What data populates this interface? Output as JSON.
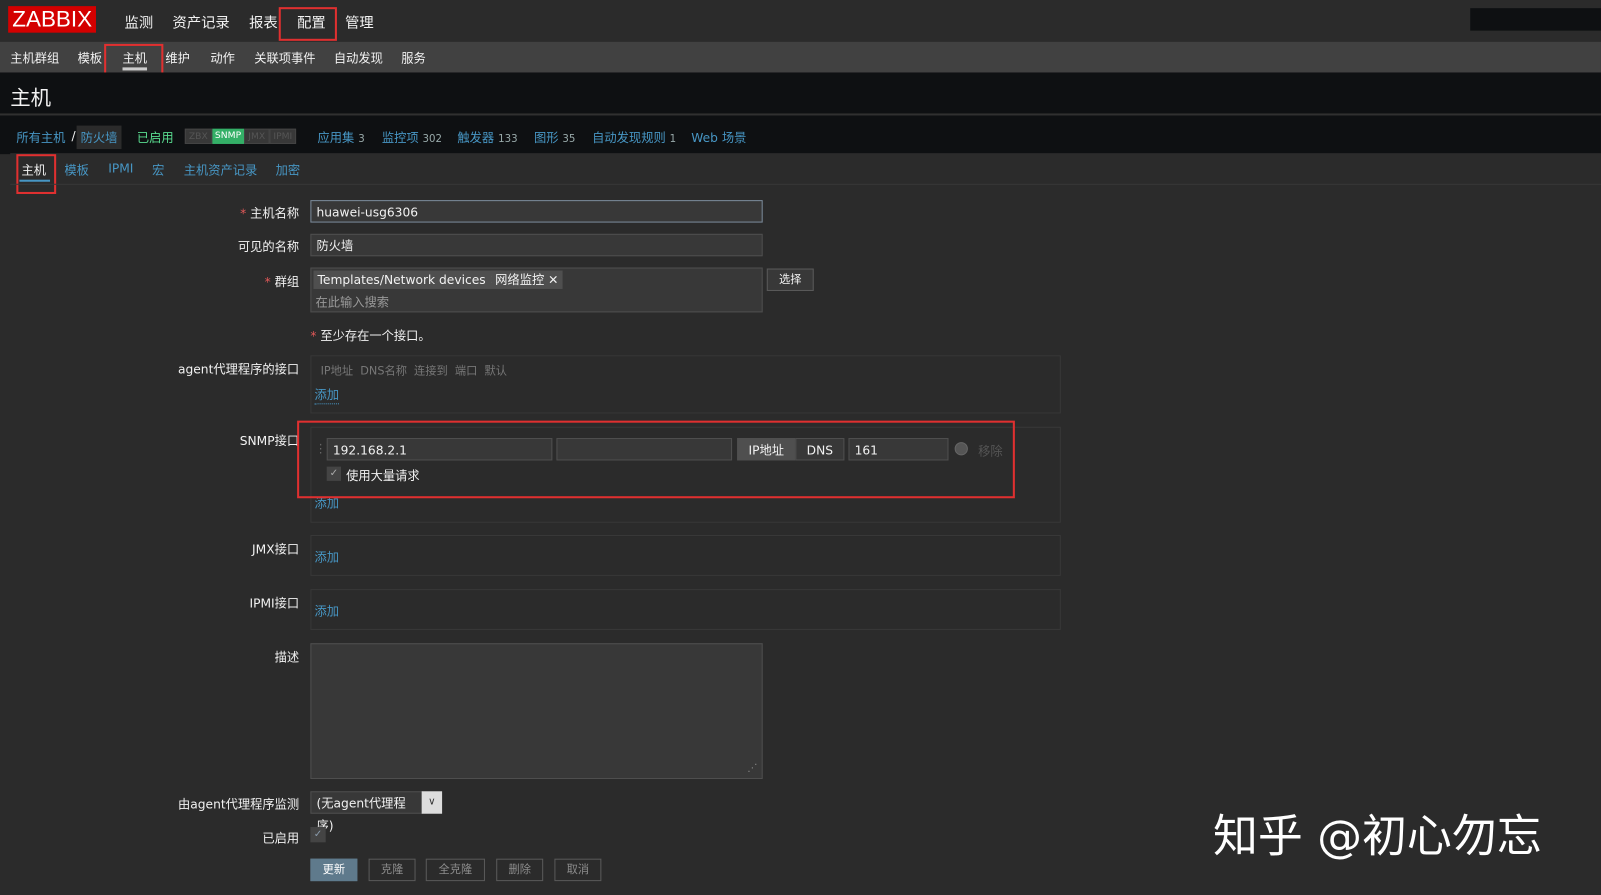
{
  "app": {
    "logo": "ZABBIX"
  },
  "main_menu": [
    "监测",
    "资产记录",
    "报表",
    "配置",
    "管理"
  ],
  "sub_menu": [
    "主机群组",
    "模板",
    "主机",
    "维护",
    "动作",
    "关联项事件",
    "自动发现",
    "服务"
  ],
  "page_title": "主机",
  "breadcrumb": {
    "all_hosts": "所有主机",
    "sep": "/",
    "host": "防火墙",
    "status": "已启用",
    "avail": [
      "ZBX",
      "SNMP",
      "JMX",
      "IPMI"
    ],
    "links": [
      {
        "label": "应用集",
        "count": "3"
      },
      {
        "label": "监控项",
        "count": "302"
      },
      {
        "label": "触发器",
        "count": "133"
      },
      {
        "label": "图形",
        "count": "35"
      },
      {
        "label": "自动发现规则",
        "count": "1"
      },
      {
        "label": "Web 场景",
        "count": ""
      }
    ]
  },
  "tabs": [
    "主机",
    "模板",
    "IPMI",
    "宏",
    "主机资产记录",
    "加密"
  ],
  "form": {
    "host_name_label": "主机名称",
    "host_name": "huawei-usg6306",
    "visible_name_label": "可见的名称",
    "visible_name": "防火墙",
    "groups_label": "群组",
    "groups": [
      "Templates/Network devices",
      "网络监控"
    ],
    "groups_placeholder": "在此输入搜索",
    "select": "选择",
    "iface_note": "至少存在一个接口。",
    "agent_label": "agent代理程序的接口",
    "agent_cols": "IP地址  DNS名称  连接到  端口  默认",
    "add": "添加",
    "snmp_label": "SNMP接口",
    "snmp_ip": "192.168.2.1",
    "snmp_dns": "",
    "connect_ip": "IP地址",
    "connect_dns": "DNS",
    "snmp_port": "161",
    "remove": "移除",
    "bulk": "使用大量请求",
    "jmx_label": "JMX接口",
    "ipmi_label": "IPMI接口",
    "desc_label": "描述",
    "desc": "",
    "proxy_label": "由agent代理程序监测",
    "proxy_value": "(无agent代理程序)",
    "enabled_label": "已启用",
    "buttons": [
      "更新",
      "克隆",
      "全克隆",
      "删除",
      "取消"
    ]
  },
  "watermark": "知乎 @初心勿忘",
  "colors": {
    "accent_link": "#4796c4",
    "highlight": "#e03030",
    "snmp_green": "#34af67"
  }
}
